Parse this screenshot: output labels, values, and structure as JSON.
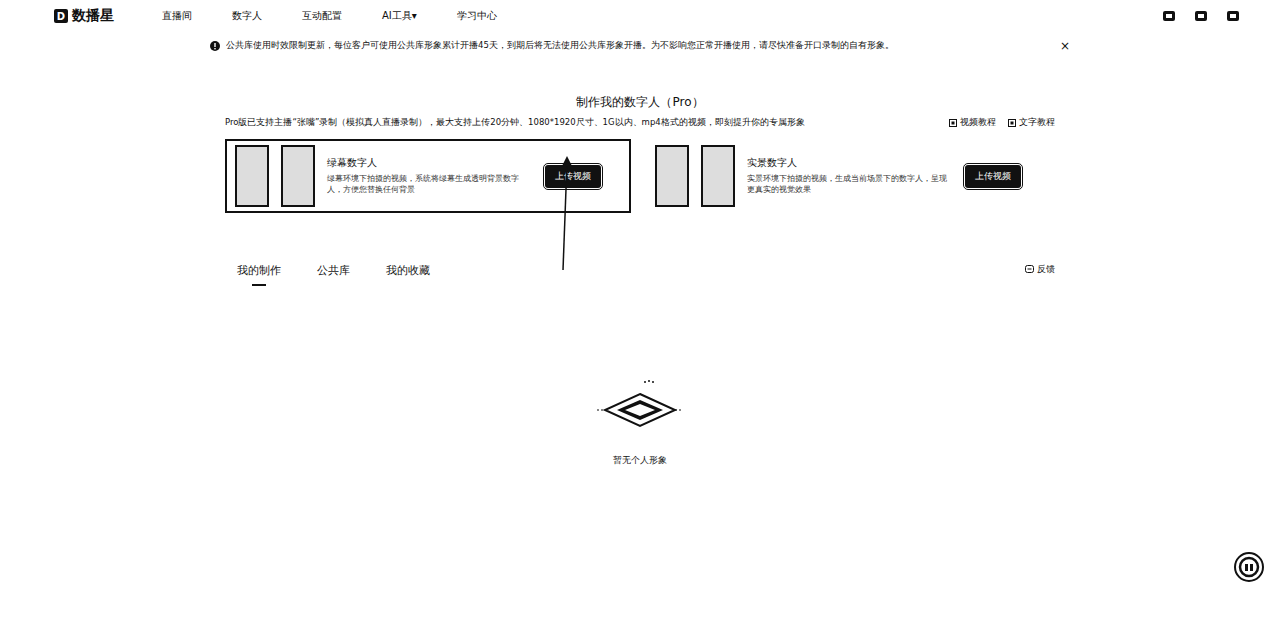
{
  "nav": {
    "logo_mark": "D",
    "logo_text": "数播星",
    "items": [
      "直播间",
      "数字人",
      "互动配置",
      "AI工具▾",
      "学习中心"
    ]
  },
  "notice": {
    "text": "公共库使用时效限制更新，每位客户可使用公共库形象累计开播45天，到期后将无法使用公共库形象开播。为不影响您正常开播使用，请尽快准备开口录制的自有形象。",
    "close": "×"
  },
  "header": {
    "title": "制作我的数字人（Pro）",
    "subtitle": "Pro版已支持主播“张嘴”录制（模拟真人直播录制），最大支持上传20分钟、1080*1920尺寸、1G以内、mp4格式的视频，即刻提升你的专属形象",
    "links": [
      "视频教程",
      "文字教程"
    ]
  },
  "cards": [
    {
      "title": "绿幕数字人",
      "description": "绿幕环境下拍摄的视频，系统将绿幕生成透明背景数字人，方便您替换任何背景",
      "button": "上传视频",
      "selected": true
    },
    {
      "title": "实景数字人",
      "description": "实景环境下拍摄的视频，生成当前场景下的数字人，呈现更真实的视觉效果",
      "button": "上传视频",
      "selected": false
    }
  ],
  "tabs": [
    {
      "label": "我的制作",
      "selected": true
    },
    {
      "label": "公共库",
      "selected": false
    },
    {
      "label": "我的收藏",
      "selected": false
    }
  ],
  "feedback": "反馈",
  "empty": {
    "text": "暂无个人形象"
  }
}
